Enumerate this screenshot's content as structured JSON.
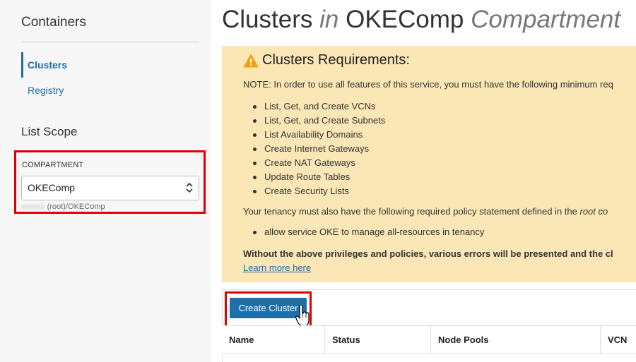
{
  "sidebar": {
    "title": "Containers",
    "items": [
      {
        "label": "Clusters",
        "active": true
      },
      {
        "label": "Registry",
        "active": false
      }
    ],
    "list_scope_title": "List Scope",
    "compartment": {
      "label": "COMPARTMENT",
      "selected": "OKEComp",
      "path_redacted": "xxxxx1",
      "path": " (root)/OKEComp"
    }
  },
  "page": {
    "title_main": "Clusters",
    "title_in": "in",
    "title_compartment": "OKEComp",
    "title_suffix": "Compartment"
  },
  "notice": {
    "heading": "Clusters Requirements:",
    "note": "NOTE: In order to use all features of this service, you must have the following minimum req",
    "requirements": [
      "List, Get, and Create VCNs",
      "List, Get, and Create Subnets",
      "List Availability Domains",
      "Create Internet Gateways",
      "Create NAT Gateways",
      "Update Route Tables",
      "Create Security Lists"
    ],
    "policy_intro": "Your tenancy must also have the following required policy statement defined in the ",
    "policy_intro_italic": "root co",
    "policy": "allow service OKE to manage all-resources in tenancy",
    "warning": "Without the above privileges and policies, various errors will be presented and the cl",
    "learn_more": "Learn more here",
    "warning_color": "#f0a30a"
  },
  "toolbar": {
    "create_label": "Create Cluster"
  },
  "table": {
    "columns": [
      "Name",
      "Status",
      "Node Pools",
      "VCN"
    ]
  },
  "colors": {
    "accent": "#1f6fab",
    "highlight": "#e00000",
    "notice_bg": "#fbe6b6"
  }
}
